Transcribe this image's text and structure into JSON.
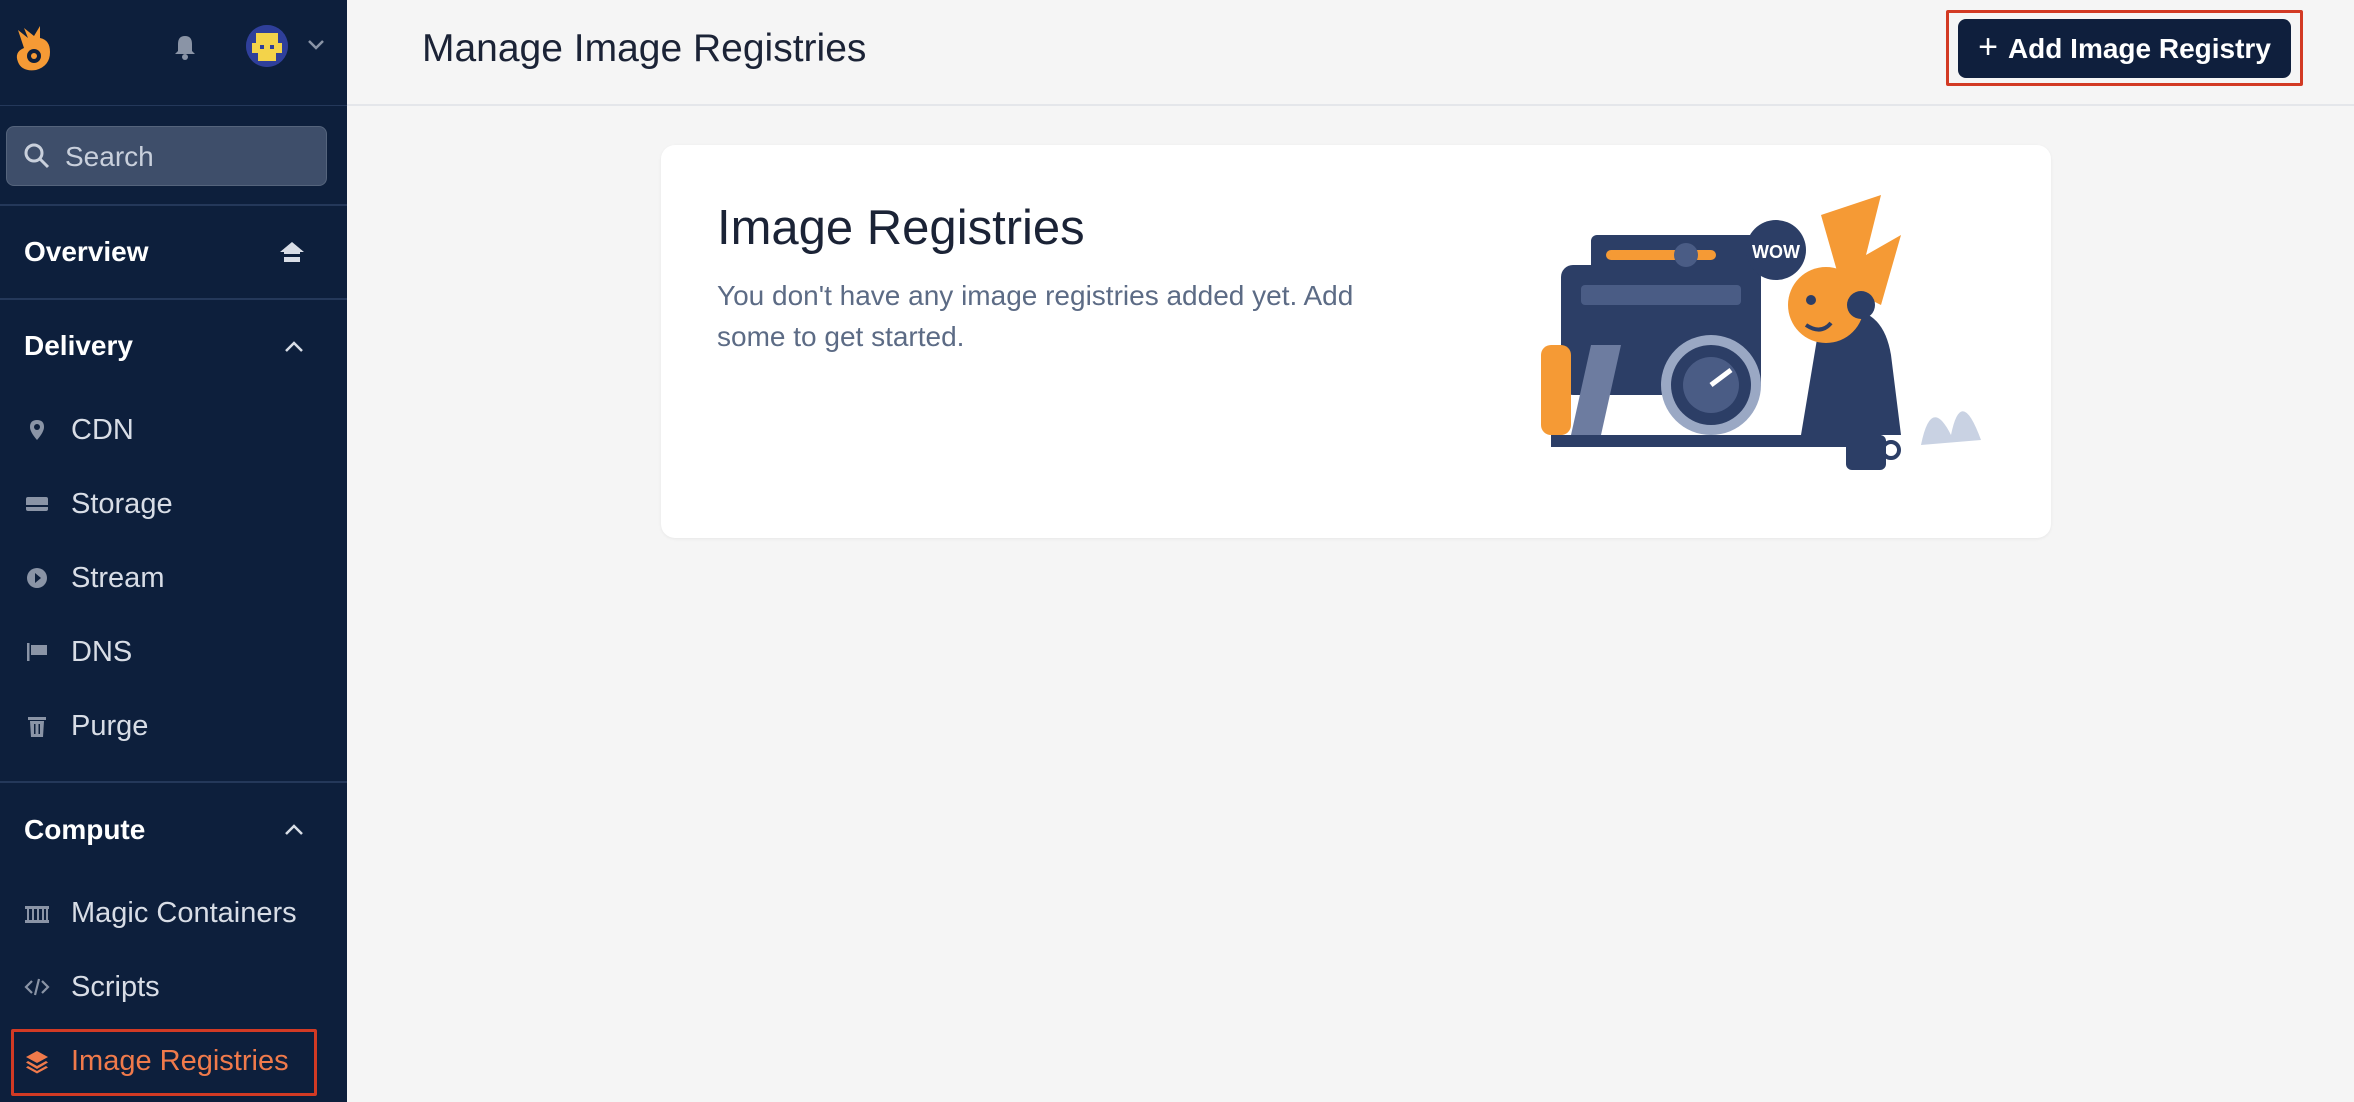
{
  "sidebar": {
    "search_placeholder": "Search",
    "overview": {
      "label": "Overview"
    },
    "delivery": {
      "label": "Delivery",
      "items": [
        {
          "label": "CDN",
          "icon": "location-pin-icon"
        },
        {
          "label": "Storage",
          "icon": "storage-icon"
        },
        {
          "label": "Stream",
          "icon": "play-circle-icon"
        },
        {
          "label": "DNS",
          "icon": "flag-icon"
        },
        {
          "label": "Purge",
          "icon": "trash-icon"
        }
      ]
    },
    "compute": {
      "label": "Compute",
      "items": [
        {
          "label": "Magic Containers",
          "icon": "containers-icon"
        },
        {
          "label": "Scripts",
          "icon": "code-icon"
        },
        {
          "label": "Image Registries",
          "icon": "layers-icon",
          "active": true
        }
      ]
    }
  },
  "header": {
    "title": "Manage Image Registries",
    "add_button_label": "Add Image Registry"
  },
  "card": {
    "title": "Image Registries",
    "text": "You don't have any image registries added yet. Add some to get started.",
    "illustration_bubble": "WOW"
  },
  "colors": {
    "sidebar_bg": "#0d1f3c",
    "accent": "#f07a4b",
    "highlight_border": "#d23a24",
    "button_bg": "#0f1f3d"
  }
}
